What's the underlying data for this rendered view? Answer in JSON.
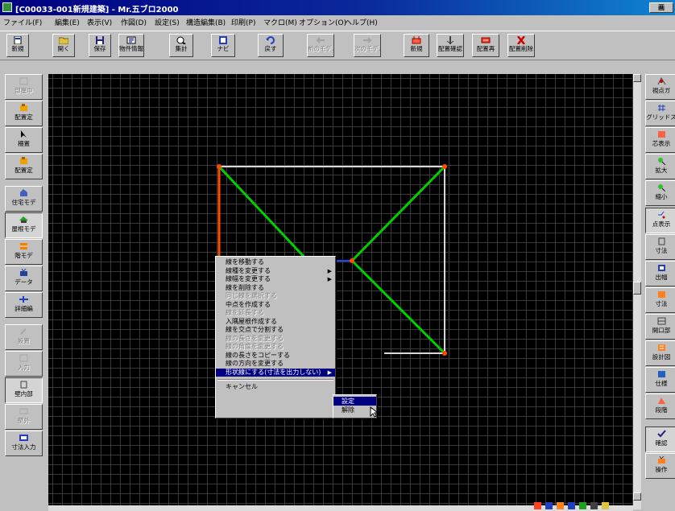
{
  "window": {
    "title": "[C00033-001新規建築] - Mr.五ブロ2000",
    "title_right": "画"
  },
  "menu": [
    "ファイル(F)",
    "編集(E)",
    "表示(V)",
    "作図(D)",
    "設定(S)",
    "構造編集(B)",
    "印刷(P)",
    "マクロ(M)",
    "オプション(O)",
    "ヘルプ(H)"
  ],
  "toolbar": {
    "new": "新規",
    "open": "開く",
    "save": "保存",
    "props": "物件情報",
    "calc": "集計",
    "navi": "ナビ",
    "undo": "戻す",
    "prev": "前のモデル",
    "next": "次のモデル",
    "new2": "新規",
    "kakuho": "配置確認",
    "rearrange": "配置再",
    "delete": "配置削除"
  },
  "leftpanel": {
    "b1": "部屋中",
    "b2": "配置定",
    "b3": "柵置",
    "b4": "配置定",
    "b5": "住宅モデ",
    "b6": "屋根モデ",
    "b7": "階モデ",
    "b8": "データ",
    "b9": "詳細編",
    "b10": "設置",
    "b11": "入力",
    "b12": "壁内部",
    "b13": "壁外",
    "b14": "寸法入力"
  },
  "rightpanel": {
    "b1": "視点ガ",
    "b2": "グリッドス",
    "b3": "芯表示",
    "b4": "拡大",
    "b5": "縮小",
    "b6": "点表示",
    "b7": "寸法",
    "b8": "出幅",
    "b9": "寸法",
    "b10": "開口部",
    "b11": "設計図",
    "b12": "仕様",
    "b13": "段階",
    "b14": "確認",
    "b15": "操作"
  },
  "context_menu": {
    "items": [
      {
        "label": "線を移動する",
        "disabled": false,
        "submenu": false
      },
      {
        "label": "線種を変更する",
        "disabled": false,
        "submenu": true
      },
      {
        "label": "線幅を変更する",
        "disabled": false,
        "submenu": true
      },
      {
        "label": "線を削除する",
        "disabled": false,
        "submenu": false
      },
      {
        "label": "同じ線を選択する",
        "disabled": true,
        "submenu": false
      },
      {
        "label": "中点を作成する",
        "disabled": false,
        "submenu": false
      },
      {
        "label": "線を延長する",
        "disabled": true,
        "submenu": false
      },
      {
        "label": "入隅屋根作成する",
        "disabled": false,
        "submenu": false
      },
      {
        "label": "線を交点で分割する",
        "disabled": false,
        "submenu": false
      },
      {
        "label": "線の長さを変更する",
        "disabled": true,
        "submenu": false
      },
      {
        "label": "線の角度を変更する",
        "disabled": true,
        "submenu": false
      },
      {
        "label": "線の長さをコピーする",
        "disabled": false,
        "submenu": false
      },
      {
        "label": "線の方向を変更する",
        "disabled": false,
        "submenu": false
      },
      {
        "label": "形状線にする(寸法を出力しない)",
        "disabled": false,
        "submenu": true,
        "highlighted": true
      }
    ],
    "cancel": "キャンセル",
    "submenu": [
      {
        "label": "設定",
        "highlighted": true
      },
      {
        "label": "解除",
        "highlighted": false
      }
    ]
  },
  "colors": {
    "green": "#00d000",
    "orange": "#ff4a00",
    "white_line": "#d8d8d8",
    "blue_line": "#1e40ff",
    "grid": "#3a3a3a"
  },
  "icons": [
    "new-doc-icon",
    "open-folder-icon",
    "save-disk-icon",
    "properties-icon",
    "calc-icon",
    "navi-icon",
    "undo-icon",
    "prev-arrow-icon",
    "next-arrow-icon",
    "delete-x-icon"
  ]
}
